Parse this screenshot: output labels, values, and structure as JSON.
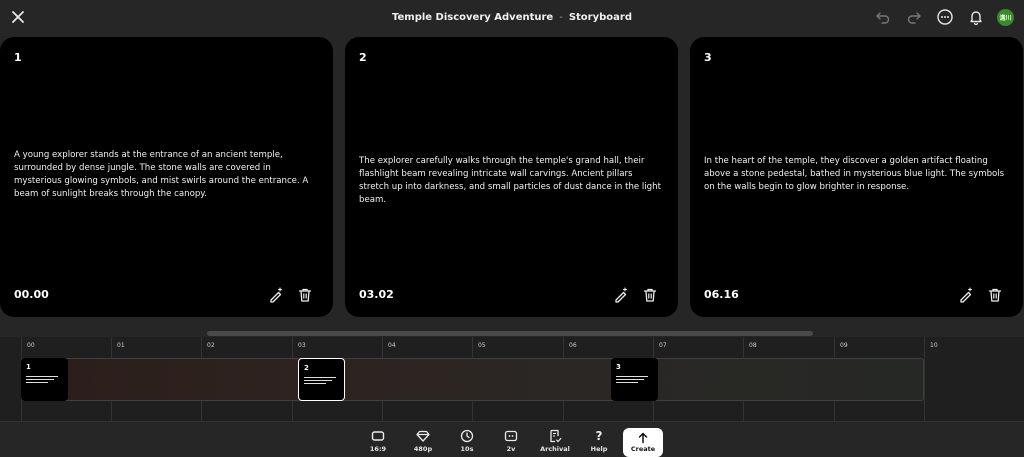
{
  "header": {
    "title": "Temple Discovery Adventure",
    "separator": "-",
    "subtitle": "Storyboard",
    "avatar_text": "溝川",
    "avatar_color": "#3a8a2b"
  },
  "scenes": [
    {
      "number": "1",
      "text": "A young explorer stands at the entrance of an ancient temple, surrounded by dense jungle. The stone walls are covered in mysterious glowing symbols, and mist swirls around the entrance. A beam of sunlight breaks through the canopy.",
      "time": "00.00"
    },
    {
      "number": "2",
      "text": "The explorer carefully walks through the temple's grand hall, their flashlight beam revealing intricate wall carvings. Ancient pillars stretch up into darkness, and small particles of dust dance in the light beam.",
      "time": "03.02"
    },
    {
      "number": "3",
      "text": "In the heart of the temple, they discover a golden artifact floating above a stone pedestal, bathed in mysterious blue light. The symbols on the walls begin to glow brighter in response.",
      "time": "06.16"
    }
  ],
  "timeline": {
    "ticks": [
      "00",
      "01",
      "02",
      "03",
      "04",
      "05",
      "06",
      "07",
      "08",
      "09",
      "10"
    ],
    "clips": [
      {
        "number": "1",
        "selected": false
      },
      {
        "number": "2",
        "selected": true
      },
      {
        "number": "3",
        "selected": false
      }
    ]
  },
  "toolbar": {
    "aspect": "16:9",
    "quality": "480p",
    "duration": "10s",
    "version": "2v",
    "archival": "Archival",
    "help": "Help",
    "help_glyph": "?",
    "create": "Create"
  }
}
